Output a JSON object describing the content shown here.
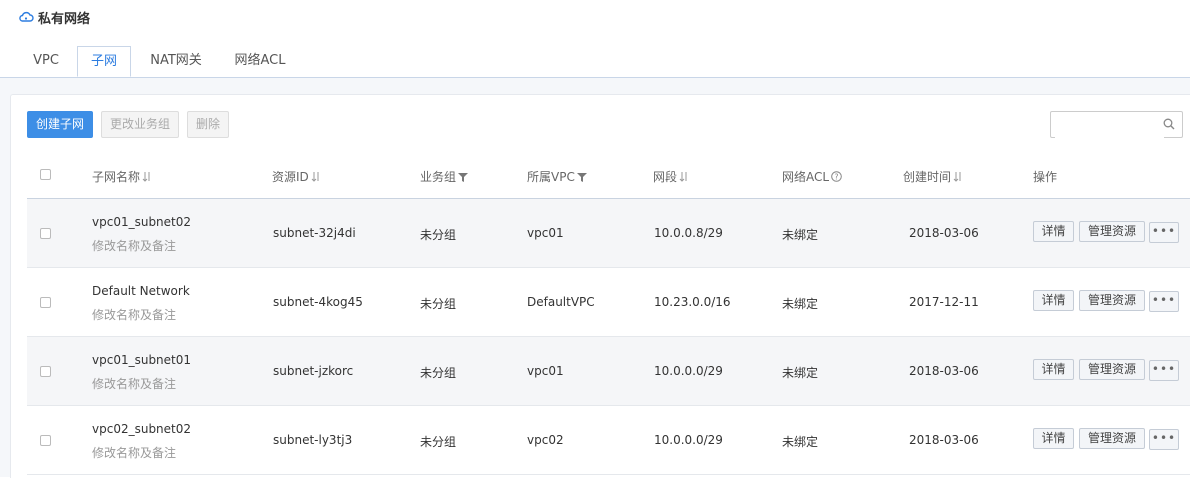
{
  "header": {
    "title": "私有网络"
  },
  "tabs": [
    {
      "label": "VPC"
    },
    {
      "label": "子网"
    },
    {
      "label": "NAT网关"
    },
    {
      "label": "网络ACL"
    }
  ],
  "toolbar": {
    "create_label": "创建子网",
    "change_group_label": "更改业务组",
    "delete_label": "删除",
    "search_placeholder": ""
  },
  "table": {
    "headers": {
      "name": "子网名称",
      "resource_id": "资源ID",
      "group": "业务组",
      "vpc": "所属VPC",
      "cidr": "网段",
      "acl": "网络ACL",
      "created": "创建时间",
      "ops": "操作"
    },
    "rows": [
      {
        "name": "vpc01_subnet02",
        "note": "修改名称及备注",
        "resource_id": "subnet-32j4di",
        "group": "未分组",
        "vpc": "vpc01",
        "cidr": "10.0.0.8/29",
        "acl": "未绑定",
        "created": "2018-03-06",
        "detail": "详情",
        "manage": "管理资源",
        "more": "•••"
      },
      {
        "name": "Default Network",
        "note": "修改名称及备注",
        "resource_id": "subnet-4kog45",
        "group": "未分组",
        "vpc": "DefaultVPC",
        "cidr": "10.23.0.0/16",
        "acl": "未绑定",
        "created": "2017-12-11",
        "detail": "详情",
        "manage": "管理资源",
        "more": "•••"
      },
      {
        "name": "vpc01_subnet01",
        "note": "修改名称及备注",
        "resource_id": "subnet-jzkorc",
        "group": "未分组",
        "vpc": "vpc01",
        "cidr": "10.0.0.0/29",
        "acl": "未绑定",
        "created": "2018-03-06",
        "detail": "详情",
        "manage": "管理资源",
        "more": "•••"
      },
      {
        "name": "vpc02_subnet02",
        "note": "修改名称及备注",
        "resource_id": "subnet-ly3tj3",
        "group": "未分组",
        "vpc": "vpc02",
        "cidr": "10.0.0.0/29",
        "acl": "未绑定",
        "created": "2018-03-06",
        "detail": "详情",
        "manage": "管理资源",
        "more": "•••"
      }
    ]
  },
  "colors": {
    "accent": "#3d8ee6",
    "tab_active": "#2d7de0"
  },
  "icons": [
    "cloud-network-icon",
    "sort-icon",
    "filter-icon",
    "help-icon",
    "search-icon"
  ]
}
